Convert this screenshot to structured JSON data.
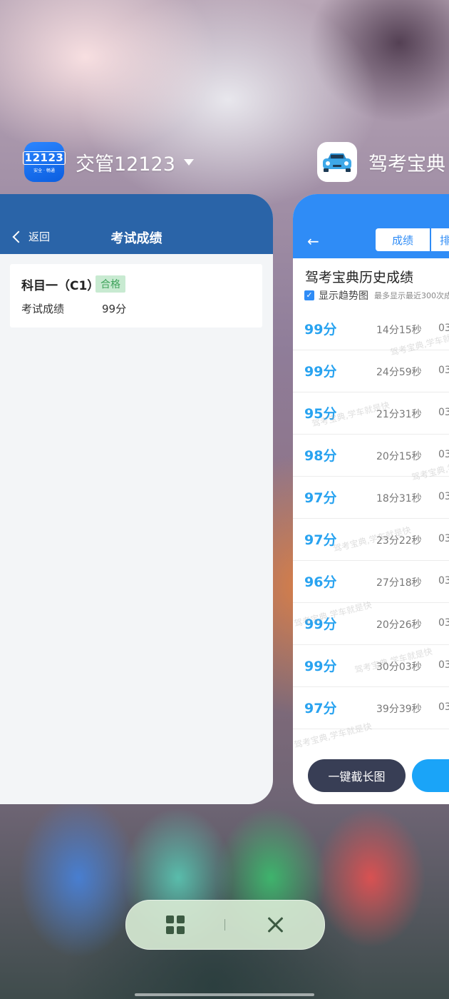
{
  "recent_apps": {
    "app1": {
      "name": "交管12123",
      "icon_text": "12123",
      "icon_subtext": "安全 · 畅通",
      "header": {
        "back_label": "返回",
        "title": "考试成绩"
      },
      "result": {
        "subject": "科目一（C1）",
        "status_badge": "合格",
        "score_label": "考试成绩",
        "score_value": "99分"
      }
    },
    "app2": {
      "name": "驾考宝典",
      "tabs": {
        "active": "成绩",
        "other": "排"
      },
      "title": "驾考宝典历史成绩",
      "trend_label": "显示趋势图",
      "trend_hint": "最多显示最近300次成",
      "records": [
        {
          "score": "99分",
          "time": "14分15秒",
          "date": "03"
        },
        {
          "score": "99分",
          "time": "24分59秒",
          "date": "03"
        },
        {
          "score": "95分",
          "time": "21分31秒",
          "date": "03"
        },
        {
          "score": "98分",
          "time": "20分15秒",
          "date": "03"
        },
        {
          "score": "97分",
          "time": "18分31秒",
          "date": "03"
        },
        {
          "score": "97分",
          "time": "23分22秒",
          "date": "03"
        },
        {
          "score": "96分",
          "time": "27分18秒",
          "date": "03"
        },
        {
          "score": "99分",
          "time": "20分26秒",
          "date": "03"
        },
        {
          "score": "99分",
          "time": "30分03秒",
          "date": "03"
        },
        {
          "score": "97分",
          "time": "39分39秒",
          "date": "03"
        }
      ],
      "watermark_text": "驾考宝典,学车就是快",
      "screenshot_button": "一键截长图"
    }
  },
  "colors": {
    "jg_header": "#2a64a8",
    "jk_header": "#2f8cf6",
    "pass_green": "#3fa35c",
    "score_blue": "#29a3f0",
    "dock_bg": "#d6e9d2"
  },
  "icons": {
    "dock_grid": "grid-icon",
    "dock_close": "close-icon",
    "dropdown": "caret-down-icon"
  }
}
